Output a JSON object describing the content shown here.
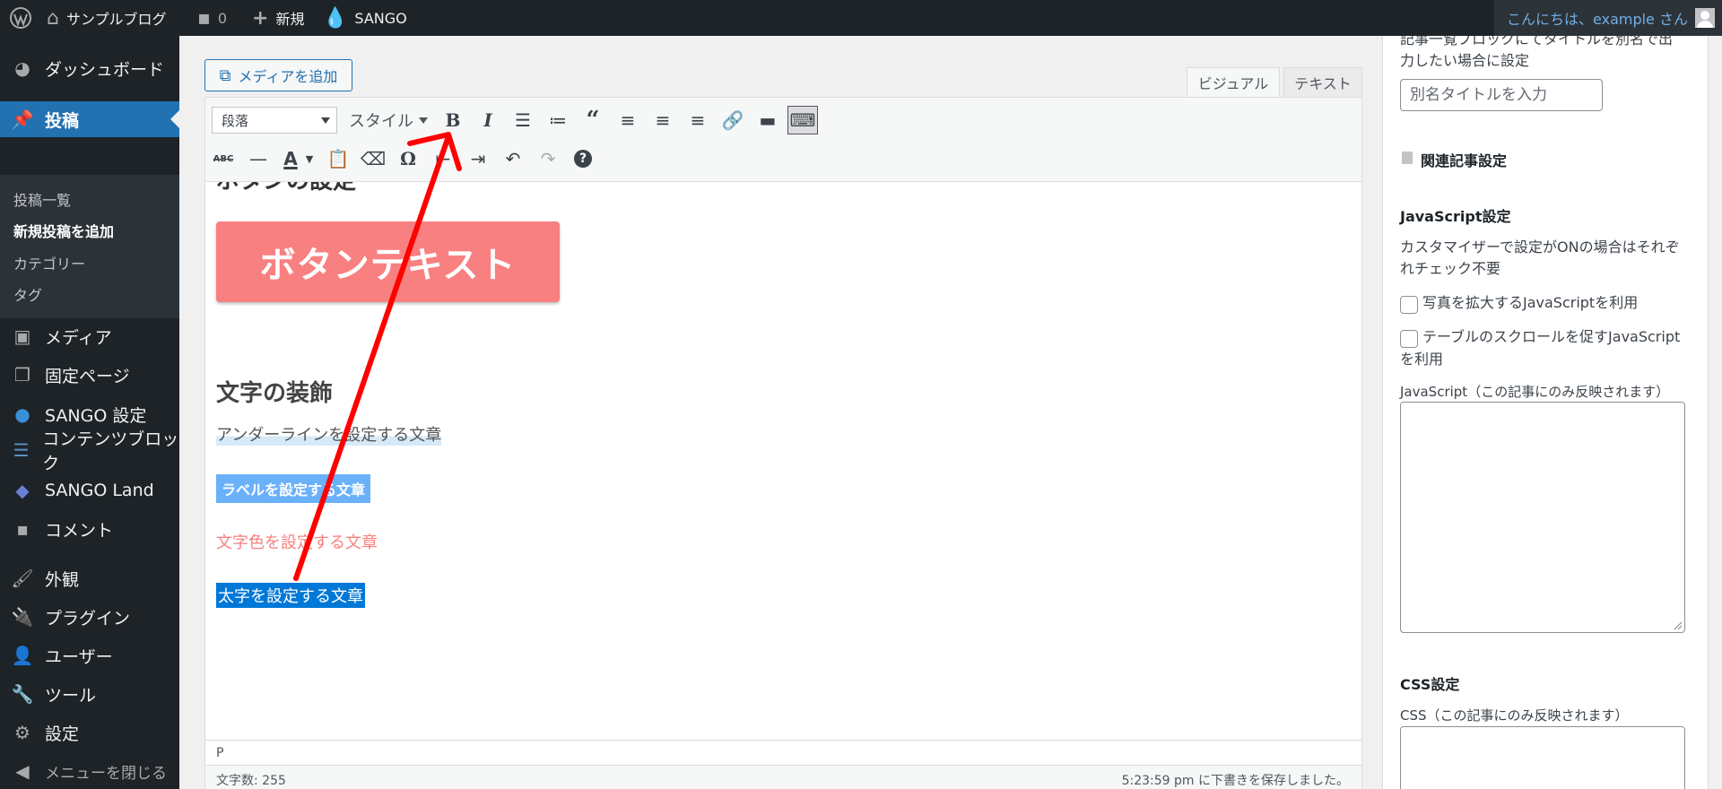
{
  "adminbar": {
    "site_name": "サンプルブログ",
    "comments_count": "0",
    "new_label": "新規",
    "sango_label": "SANGO",
    "greeting": "こんにちは、example さん"
  },
  "sidebar": {
    "dashboard": "ダッシュボード",
    "posts": "投稿",
    "submenu": {
      "all_posts": "投稿一覧",
      "add_new": "新規投稿を追加",
      "categories": "カテゴリー",
      "tags": "タグ"
    },
    "media": "メディア",
    "pages": "固定ページ",
    "sango_settings": "SANGO 設定",
    "content_blocks": "コンテンツブロック",
    "sango_land": "SANGO Land",
    "comments": "コメント",
    "appearance": "外観",
    "plugins": "プラグイン",
    "users": "ユーザー",
    "tools": "ツール",
    "settings": "設定",
    "collapse": "メニューを閉じる"
  },
  "editor": {
    "media_button": "メディアを追加",
    "tabs": {
      "visual": "ビジュアル",
      "text": "テキスト"
    },
    "format_select": "段落",
    "style_select": "スタイル",
    "content": {
      "partial_heading": "ボタンの設定",
      "demo_button": "ボタンテキスト",
      "deco_heading": "文字の装飾",
      "underline_text": "アンダーラインを設定する文章",
      "label_text": "ラベルを設定する文章",
      "color_text": "文字色を設定する文章",
      "bold_text": "太字を設定する文章"
    },
    "path": "P",
    "word_count": "文字数: 255",
    "autosave": "5:23:59 pm に下書きを保存しました。"
  },
  "side_panel": {
    "intro_line1": "記事一覧ブロックにてタイトルを別名で出",
    "intro_line2": "力したい場合に設定",
    "alias_placeholder": "別名タイトルを入力",
    "related_heading": "関連記事設定",
    "js_heading": "JavaScript設定",
    "js_desc_line1": "カスタマイザーで設定がONの場合はそれぞ",
    "js_desc_line2": "れチェック不要",
    "cb1_label": "写真を拡大するJavaScriptを利用",
    "cb2_label_line1": "テーブルのスクロールを促すJavaScript",
    "cb2_label_line2": "を利用",
    "js_textarea_label": "JavaScript（この記事にのみ反映されます）",
    "css_heading": "CSS設定",
    "css_textarea_label": "CSS（この記事にのみ反映されます）"
  },
  "colors": {
    "admin_dark": "#1d2327",
    "accent_blue": "#2271b1",
    "button_pink": "#f88080",
    "label_blue": "#6ab1fa",
    "annotation_red": "#ff0000"
  }
}
